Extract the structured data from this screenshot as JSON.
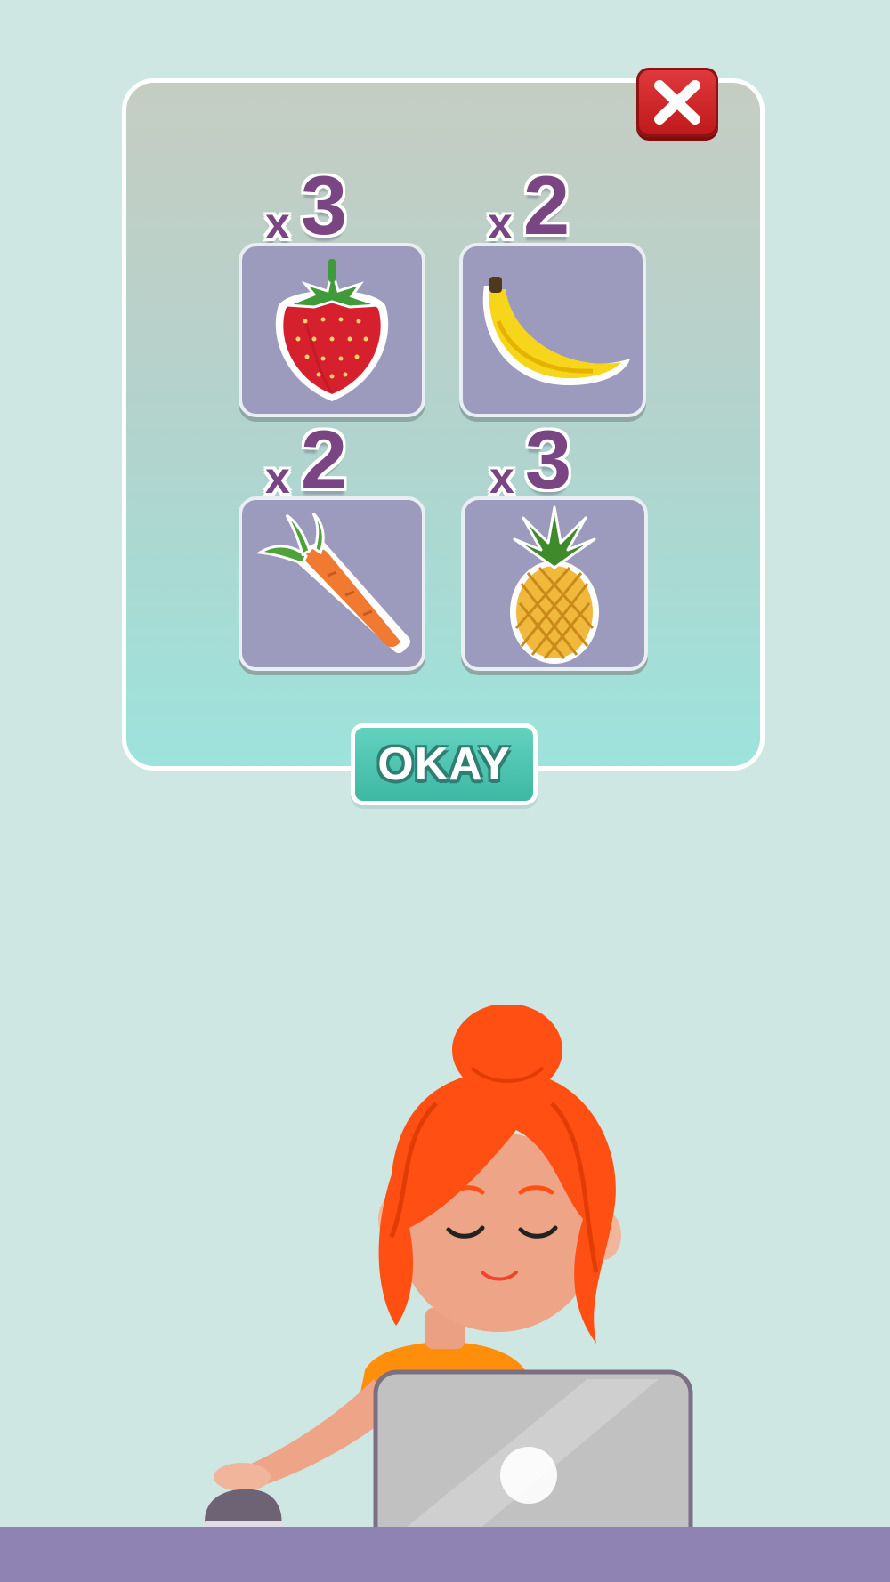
{
  "dialog": {
    "close_icon": "close-x-icon",
    "ok_label": "OKAY",
    "items": [
      {
        "name": "strawberry",
        "prefix": "x",
        "count": "3"
      },
      {
        "name": "banana",
        "prefix": "x",
        "count": "2"
      },
      {
        "name": "carrot",
        "prefix": "x",
        "count": "2"
      },
      {
        "name": "pineapple",
        "prefix": "x",
        "count": "3"
      }
    ]
  },
  "colors": {
    "background": "#cfe7e3",
    "close_button": "#d42a2d",
    "ok_button": "#4cc3ae",
    "quantity_text": "#7a4583",
    "tile": "#9d9bbd",
    "desk": "#8f83b3"
  }
}
